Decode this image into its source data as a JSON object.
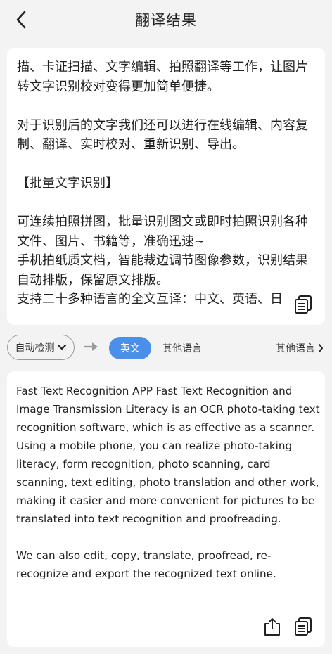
{
  "header": {
    "title": "翻译结果"
  },
  "source": {
    "text": "描、卡证扫描、文字编辑、拍照翻译等工作，让图片转文字识别校对变得更加简单便捷。\n\n对于识别后的文字我们还可以进行在线编辑、内容复制、翻译、实时校对、重新识别、导出。\n\n【批量文字识别】\n\n可连续拍照拼图，批量识别图文或即时拍照识别各种文件、图片、书籍等，准确迅速~\n手机拍纸质文档，智能裁边调节图像参数，识别结果自动排版，保留原文排版。\n支持二十多种语言的全文互译：中文、英语、日"
  },
  "languages": {
    "source_label": "自动检测",
    "target_active": "英文",
    "other_label": "其他语言",
    "more_label": "其他语言"
  },
  "target": {
    "text": "Fast Text Recognition APP Fast Text Recognition and Image Transmission Literacy is an OCR photo-taking text recognition software, which is as effective as a scanner. Using a mobile phone, you can realize photo-taking literacy, form recognition, photo scanning, card scanning, text editing, photo translation and other work, making it easier and more convenient for pictures to be translated into text recognition and proofreading.\n\nWe can also edit, copy, translate, proofread, re-recognize and export the recognized text online."
  },
  "icons": {
    "back": "chevron-left-icon",
    "copy": "copy-icon",
    "share": "share-icon",
    "arrow": "arrow-right-icon",
    "dropdown": "chevron-down-icon",
    "more": "chevron-right-icon"
  },
  "colors": {
    "accent": "#4a90e8",
    "background": "#f3f3f4",
    "card": "#ffffff"
  }
}
